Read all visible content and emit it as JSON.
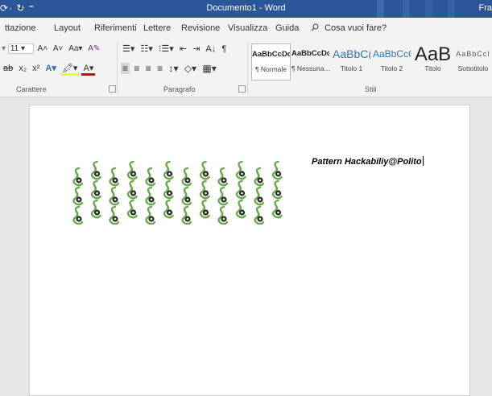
{
  "titlebar": {
    "qat": "⟳· ↻  ⁼",
    "doc_title": "Documento1 - Word",
    "user": "Fra"
  },
  "tabs": [
    "ttazione",
    "Layout",
    "Riferimenti",
    "Lettere",
    "Revisione",
    "Visualizza",
    "Guida"
  ],
  "tell_me": {
    "icon": "search-icon",
    "placeholder": "Cosa vuoi fare?"
  },
  "font_group": {
    "font_size": "11",
    "label": "Carattere",
    "row1_buttons": [
      "A˄",
      "A˅",
      "Aa▾",
      "A✎"
    ],
    "row2_buttons": [
      "ab",
      "x₂",
      "x²",
      "A▾",
      "🖍▾",
      "A▾"
    ]
  },
  "paragraph_group": {
    "label": "Paragrafo",
    "row1_buttons": [
      "☰▾",
      "☷▾",
      "⁝☰▾",
      "⇤",
      "⇥",
      "A↓",
      "¶"
    ],
    "row2_buttons": [
      "≡",
      "≡",
      "≡",
      "≡",
      "↕▾",
      "◇▾",
      "▦▾"
    ]
  },
  "styles_group": {
    "label": "Stili",
    "cards": [
      {
        "sample": "AaBbCcDc",
        "name": "¶ Normale",
        "selected": true
      },
      {
        "sample": "AaBbCcDc",
        "name": "¶ Nessuna..."
      },
      {
        "sample": "AaBbC(",
        "name": "Titolo 1"
      },
      {
        "sample": "AaBbCcC",
        "name": "Titolo 2"
      },
      {
        "sample": "AaB",
        "name": "Titolo"
      },
      {
        "sample": "AaBbCcI",
        "name": "Sottotitolo"
      }
    ]
  },
  "document": {
    "caption": "Pattern Hackabiliy@Polito",
    "pattern_rows": 3,
    "pattern_cols": 12
  },
  "colors": {
    "titlebar": "#2b579a",
    "ribbon": "#f3f3f3",
    "heading_blue": "#2e74b5",
    "pattern_green": "#6aa84f",
    "pattern_dark": "#2b2b2b"
  }
}
